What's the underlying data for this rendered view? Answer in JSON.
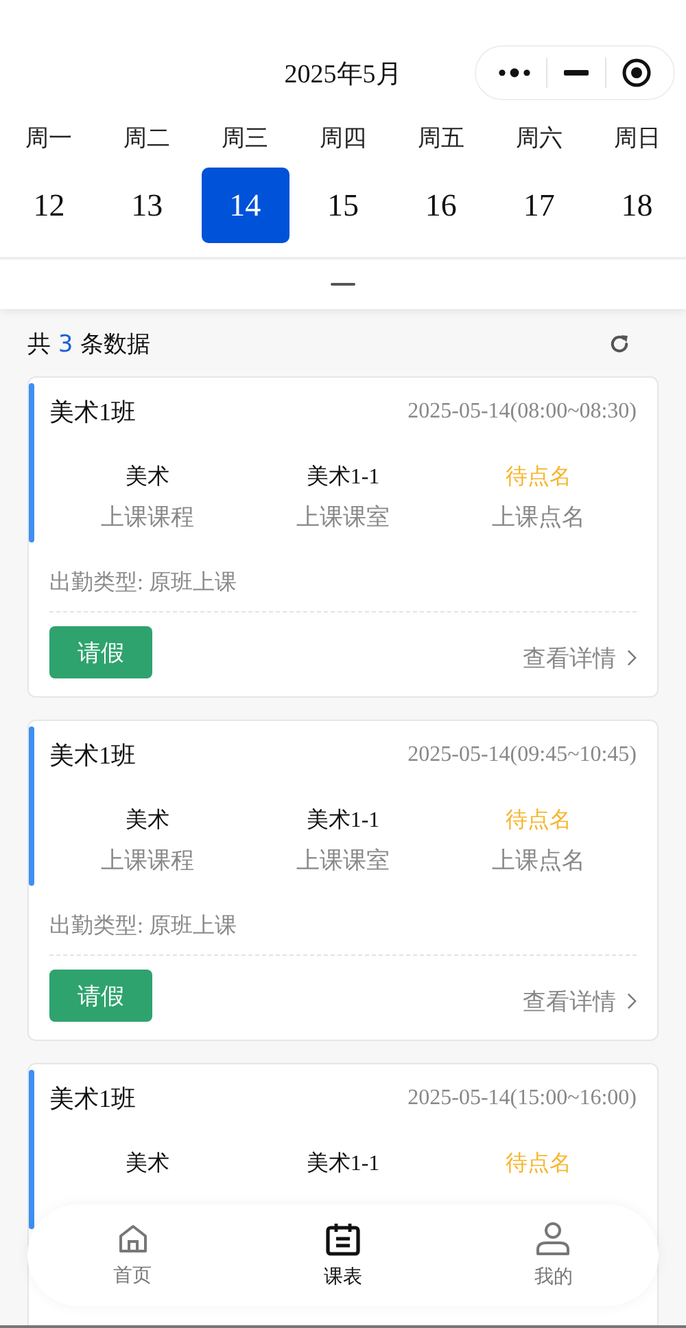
{
  "calendar": {
    "title": "2025年5月",
    "weekdays": [
      "周一",
      "周二",
      "周三",
      "周四",
      "周五",
      "周六",
      "周日"
    ],
    "dates": [
      {
        "label": "12",
        "selected": false
      },
      {
        "label": "13",
        "selected": false
      },
      {
        "label": "14",
        "selected": true
      },
      {
        "label": "15",
        "selected": false
      },
      {
        "label": "16",
        "selected": false
      },
      {
        "label": "17",
        "selected": false
      },
      {
        "label": "18",
        "selected": false
      }
    ]
  },
  "summary": {
    "prefix": "共",
    "count": "3",
    "suffix": "条数据"
  },
  "cards": [
    {
      "class_name": "美术1班",
      "time": "2025-05-14(08:00~08:30)",
      "fields": [
        {
          "kind": "plain",
          "value": "美术",
          "label": "上课课程"
        },
        {
          "kind": "plain",
          "value": "美术1-1",
          "label": "上课课室"
        },
        {
          "kind": "status",
          "value": "待点名",
          "label": "上课点名"
        }
      ],
      "attendance": "出勤类型: 原班上课",
      "leave_button": "请假",
      "detail_link": "查看详情"
    },
    {
      "class_name": "美术1班",
      "time": "2025-05-14(09:45~10:45)",
      "fields": [
        {
          "kind": "plain",
          "value": "美术",
          "label": "上课课程"
        },
        {
          "kind": "plain",
          "value": "美术1-1",
          "label": "上课课室"
        },
        {
          "kind": "status",
          "value": "待点名",
          "label": "上课点名"
        }
      ],
      "attendance": "出勤类型: 原班上课",
      "leave_button": "请假",
      "detail_link": "查看详情"
    },
    {
      "class_name": "美术1班",
      "time": "2025-05-14(15:00~16:00)",
      "fields": [
        {
          "kind": "plain",
          "value": "美术"
        },
        {
          "kind": "plain",
          "value": "美术1-1"
        },
        {
          "kind": "status",
          "value": "待点名"
        }
      ]
    }
  ],
  "tab_bar": [
    {
      "kind": "home",
      "label": "首页",
      "selected": false
    },
    {
      "kind": "schedule",
      "label": "课表",
      "selected": true
    },
    {
      "kind": "profile",
      "label": "我的",
      "selected": false
    }
  ]
}
